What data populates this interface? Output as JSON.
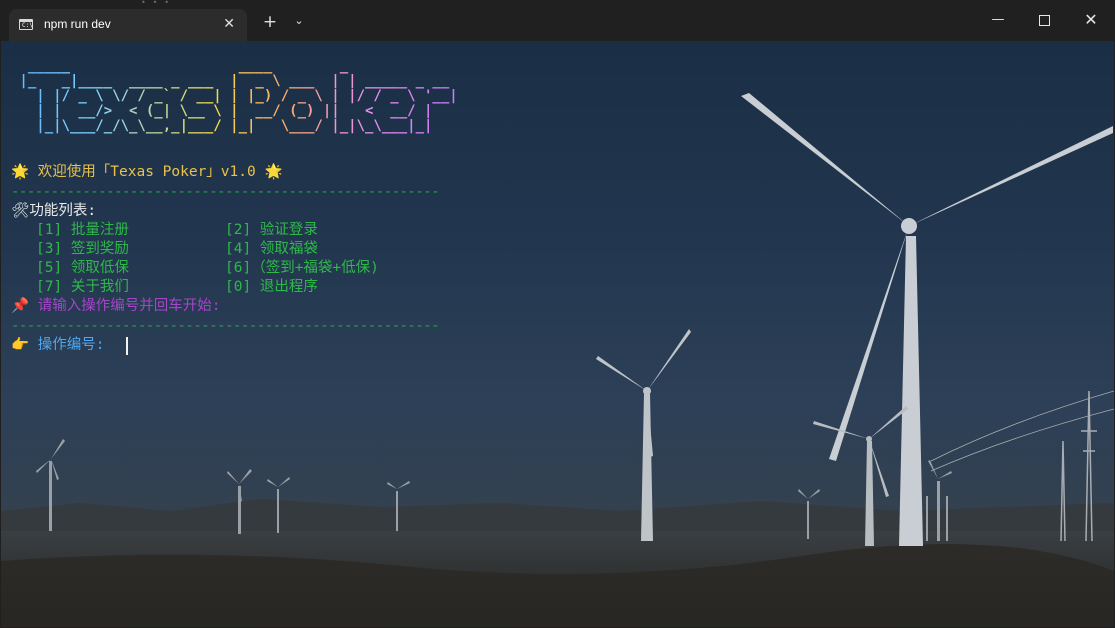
{
  "window": {
    "tab_title": "npm run dev",
    "tab_icon": "terminal-icon",
    "tab_icon_text": "C:\\",
    "close_tab_glyph": "✕",
    "new_tab_glyph": "+",
    "dropdown_glyph": "⌄",
    "min_glyph": "—",
    "close_glyph": "✕"
  },
  "terminal": {
    "ascii_banner": "  _____                    ____        _\n |_   _|____  ____ _ ___  |  _ \\ ___  | | _____ _ __\n   | |/ _ \\ \\/ / _` / __| | |_) / _ \\ | |/ / _ \\ '__|\n   | |  __/>  < (_| \\__ \\ |  __/ (_) ||   <  __/ |\n   |_|\\___/_/\\_\\__,_|___/ |_|   \\___/ |_|\\_\\___|_|",
    "welcome": "🌟 欢迎使用「Texas Poker」v1.0 🌟",
    "separator": "------------------------------------------------------",
    "menu_title": "🛠功能列表:",
    "menu": [
      {
        "left": "[1] 批量注册",
        "right": "[2] 验证登录"
      },
      {
        "left": "[3] 签到奖励",
        "right": "[4] 领取福袋"
      },
      {
        "left": "[5] 领取低保",
        "right": "[6]（签到+福袋+低保)"
      },
      {
        "left": "[7] 关于我们",
        "right": "[0] 退出程序"
      }
    ],
    "hint": "📌 请输入操作编号并回车开始:",
    "prompt": "👉 操作编号: "
  },
  "colors": {
    "welcome": "#e8c24a",
    "separator": "#22a34a",
    "menu_items": "#2fb84a",
    "hint": "#a545c9",
    "prompt": "#4fa8f0"
  }
}
